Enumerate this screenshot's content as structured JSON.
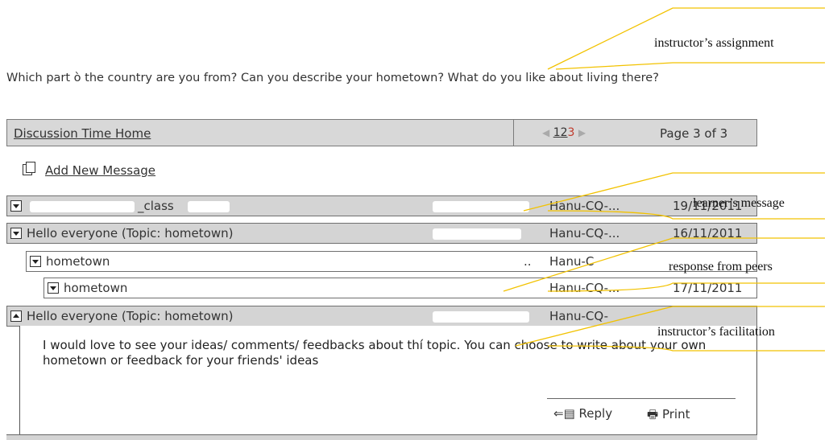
{
  "question": "Which part ò the country are you from? Can you describe your hometown? What do you like about living there?",
  "header": {
    "home_link": "Discussion Time Home",
    "pages": [
      "1",
      "2",
      "3"
    ],
    "page_label": "Page 3 of 3"
  },
  "add_message": "Add New Message",
  "rows": [
    {
      "subject": "_class",
      "author": "Hanu-CQ-...",
      "date": "19/11/2011"
    },
    {
      "subject": "Hello everyone (Topic: hometown)",
      "author": "Hanu-CQ-...",
      "date": "16/11/2011"
    },
    {
      "subject": "hometown",
      "author": "Hanu-C",
      "date": ""
    },
    {
      "subject": "hometown",
      "author": "Hanu-CQ-...",
      "date": "17/11/2011"
    },
    {
      "subject": "Hello everyone (Topic: hometown)",
      "author": "Hanu-CQ-",
      "date": ""
    }
  ],
  "message_body": "I would love to see your ideas/ comments/ feedbacks about thí topic. You can choose to write about your own hometown or feedback for your friends' ideas",
  "actions": {
    "reply": "Reply",
    "print": "Print"
  },
  "callouts": {
    "assignment": "instructor’s assignment",
    "learner": "learner’s message",
    "peers": "response from peers",
    "facilitation": "instructor’s facilitation"
  },
  "colors": {
    "row_bg": "#d4d4d4",
    "callout_line": "#f2c200",
    "current_page": "#c0392b"
  }
}
